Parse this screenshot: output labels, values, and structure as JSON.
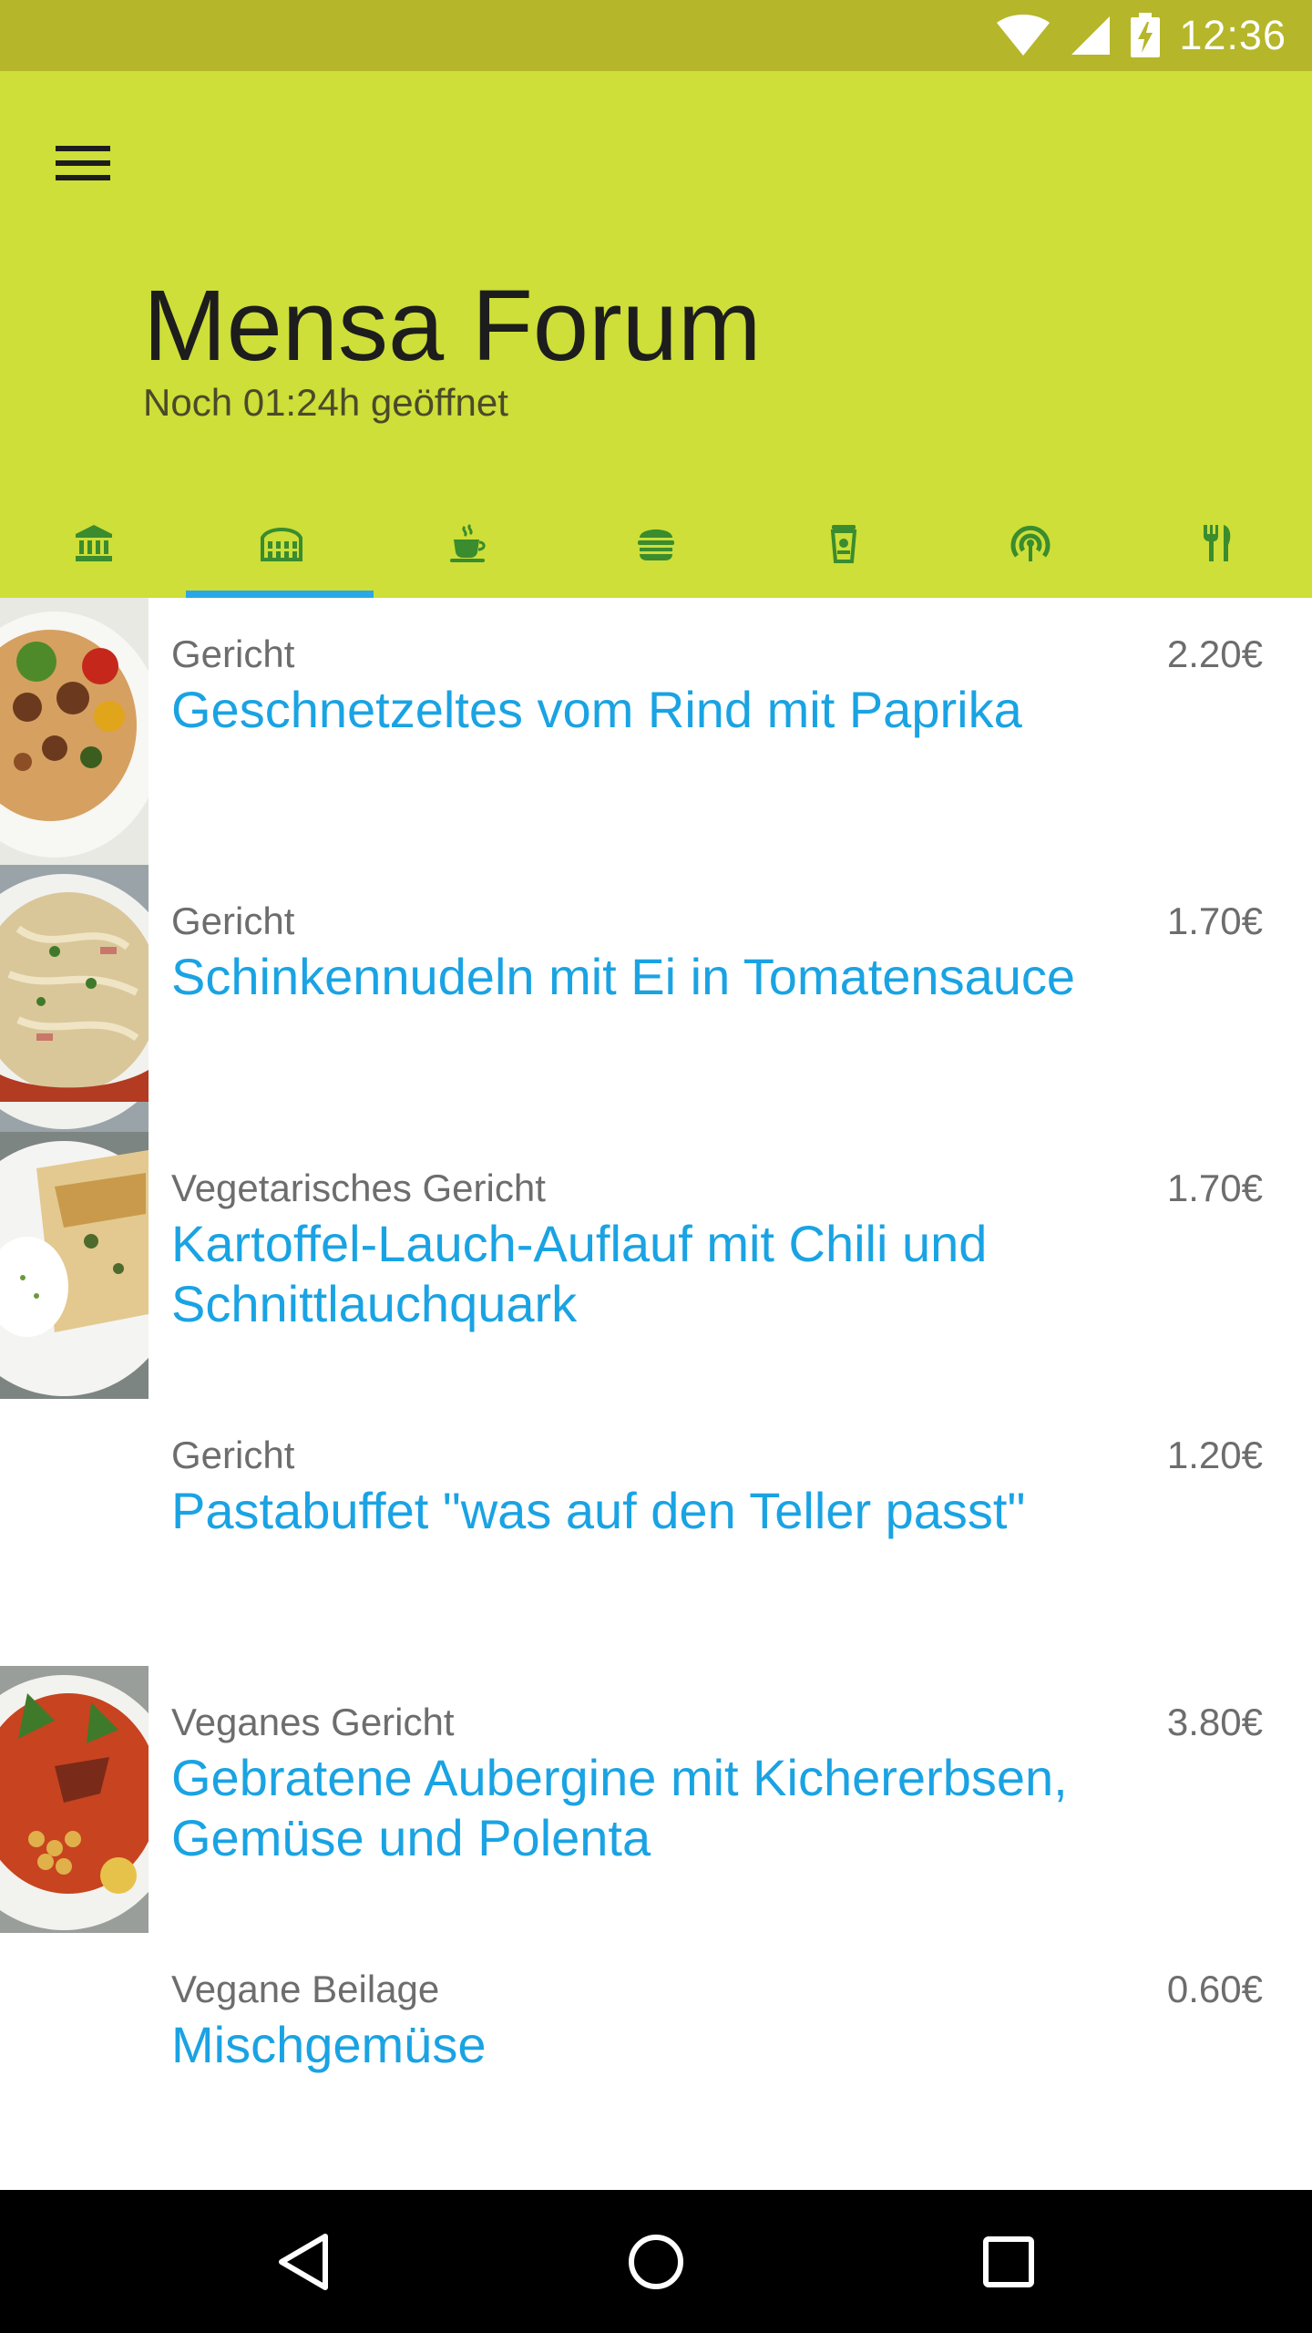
{
  "status_bar": {
    "time": "12:36",
    "icons": [
      "wifi-icon",
      "cell-signal-icon",
      "battery-charging-icon"
    ]
  },
  "header": {
    "title": "Mensa Forum",
    "subtitle": "Noch 01:24h geöffnet",
    "background": "#cddf38",
    "menu_icon": "hamburger-menu-icon"
  },
  "tabs": [
    {
      "icon": "bank-icon",
      "selected": false
    },
    {
      "icon": "colosseum-icon",
      "selected": true
    },
    {
      "icon": "coffee-cup-icon",
      "selected": false
    },
    {
      "icon": "burger-icon",
      "selected": false
    },
    {
      "icon": "drink-cup-icon",
      "selected": false
    },
    {
      "icon": "broadcast-icon",
      "selected": false
    },
    {
      "icon": "cutlery-icon",
      "selected": false
    }
  ],
  "accent_color": "#1aa3e3",
  "meals": [
    {
      "category": "Gericht",
      "name": "Geschnetzeltes vom Rind mit Paprika",
      "price": "2.20€",
      "has_image": true
    },
    {
      "category": "Gericht",
      "name": "Schinkennudeln mit Ei in Tomatensauce",
      "price": "1.70€",
      "has_image": true
    },
    {
      "category": "Vegetarisches Gericht",
      "name": "Kartoffel-Lauch-Auflauf mit Chili und Schnittlauchquark",
      "price": "1.70€",
      "has_image": true
    },
    {
      "category": "Gericht",
      "name": "Pastabuffet \"was auf den Teller passt\"",
      "price": "1.20€",
      "has_image": false
    },
    {
      "category": "Veganes Gericht",
      "name": "Gebratene Aubergine mit Kichererbsen, Gemüse und Polenta",
      "price": "3.80€",
      "has_image": true
    },
    {
      "category": "Vegane Beilage",
      "name": "Mischgemüse",
      "price": "0.60€",
      "has_image": false
    }
  ],
  "nav_bar": {
    "buttons": [
      "back-icon",
      "home-icon",
      "recents-icon"
    ]
  }
}
